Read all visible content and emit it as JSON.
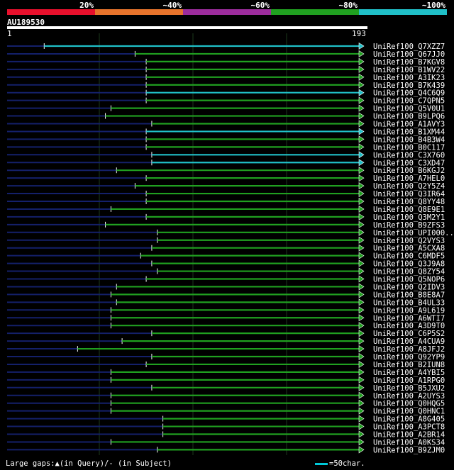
{
  "header": {
    "query_id": "AU189530",
    "ruler_start": "1",
    "ruler_end": "193"
  },
  "color_legend": [
    {
      "label": "20%",
      "color": "#e8102c"
    },
    {
      "label": "~40%",
      "color": "#e8742c"
    },
    {
      "label": "~60%",
      "color": "#9c2c9c"
    },
    {
      "label": "~80%",
      "color": "#20a020"
    },
    {
      "label": "~100%",
      "color": "#20c0c8"
    }
  ],
  "footer": {
    "gaps_text": "Large gaps:▲(in Query)/- (in Subject)",
    "scale_text": "=50char."
  },
  "chart_data": {
    "type": "alignment",
    "query_length": 193,
    "hits": [
      {
        "name": "UniRef100_Q7XZZ7",
        "start": 21,
        "end": 193,
        "identity": "~100%"
      },
      {
        "name": "UniRef100_Q67JJ0",
        "start": 70,
        "end": 193,
        "identity": "~80%"
      },
      {
        "name": "UniRef100_B7KGV8",
        "start": 76,
        "end": 193,
        "identity": "~80%"
      },
      {
        "name": "UniRef100_B1WV22",
        "start": 76,
        "end": 193,
        "identity": "~80%"
      },
      {
        "name": "UniRef100_A3IK23",
        "start": 76,
        "end": 193,
        "identity": "~80%"
      },
      {
        "name": "UniRef100_B7K439",
        "start": 76,
        "end": 193,
        "identity": "~80%"
      },
      {
        "name": "UniRef100_Q4C6Q9",
        "start": 76,
        "end": 193,
        "identity": "~100%"
      },
      {
        "name": "UniRef100_C7QPN5",
        "start": 76,
        "end": 193,
        "identity": "~80%"
      },
      {
        "name": "UniRef100_Q5V0U1",
        "start": 57,
        "end": 193,
        "identity": "~80%"
      },
      {
        "name": "UniRef100_B9LPQ6",
        "start": 54,
        "end": 193,
        "identity": "~80%"
      },
      {
        "name": "UniRef100_A1AVY3",
        "start": 79,
        "end": 193,
        "identity": "~80%"
      },
      {
        "name": "UniRef100_B1XM44",
        "start": 76,
        "end": 193,
        "identity": "~100%"
      },
      {
        "name": "UniRef100_B4B3W4",
        "start": 76,
        "end": 193,
        "identity": "~80%"
      },
      {
        "name": "UniRef100_B0C117",
        "start": 76,
        "end": 193,
        "identity": "~80%"
      },
      {
        "name": "UniRef100_C3X760",
        "start": 79,
        "end": 193,
        "identity": "~100%"
      },
      {
        "name": "UniRef100_C3XD47",
        "start": 79,
        "end": 193,
        "identity": "~100%"
      },
      {
        "name": "UniRef100_B6KGJ2",
        "start": 60,
        "end": 193,
        "identity": "~80%"
      },
      {
        "name": "UniRef100_A7HEL0",
        "start": 76,
        "end": 193,
        "identity": "~80%"
      },
      {
        "name": "UniRef100_Q2Y5Z4",
        "start": 70,
        "end": 193,
        "identity": "~80%"
      },
      {
        "name": "UniRef100_Q3IR64",
        "start": 76,
        "end": 193,
        "identity": "~80%"
      },
      {
        "name": "UniRef100_Q8YY48",
        "start": 76,
        "end": 193,
        "identity": "~80%"
      },
      {
        "name": "UniRef100_Q8E9E1",
        "start": 57,
        "end": 193,
        "identity": "~80%"
      },
      {
        "name": "UniRef100_Q3M2Y1",
        "start": 76,
        "end": 193,
        "identity": "~80%"
      },
      {
        "name": "UniRef100_B9ZFS3",
        "start": 54,
        "end": 193,
        "identity": "~80%"
      },
      {
        "name": "UniRef100_UPI000..",
        "start": 82,
        "end": 193,
        "identity": "~80%"
      },
      {
        "name": "UniRef100_Q2VYS3",
        "start": 82,
        "end": 193,
        "identity": "~80%"
      },
      {
        "name": "UniRef100_A5CXA8",
        "start": 79,
        "end": 193,
        "identity": "~80%"
      },
      {
        "name": "UniRef100_C6MDF5",
        "start": 73,
        "end": 193,
        "identity": "~80%"
      },
      {
        "name": "UniRef100_Q3J9A8",
        "start": 79,
        "end": 193,
        "identity": "~80%"
      },
      {
        "name": "UniRef100_Q8ZY54",
        "start": 82,
        "end": 193,
        "identity": "~80%"
      },
      {
        "name": "UniRef100_Q5NOP6",
        "start": 76,
        "end": 193,
        "identity": "~80%"
      },
      {
        "name": "UniRef100_Q2IDV3",
        "start": 60,
        "end": 193,
        "identity": "~80%"
      },
      {
        "name": "UniRef100_B8E8A7",
        "start": 57,
        "end": 193,
        "identity": "~80%"
      },
      {
        "name": "UniRef100_B4UL33",
        "start": 60,
        "end": 193,
        "identity": "~80%"
      },
      {
        "name": "UniRef100_A9L619",
        "start": 57,
        "end": 193,
        "identity": "~80%"
      },
      {
        "name": "UniRef100_A6WTI7",
        "start": 57,
        "end": 193,
        "identity": "~80%"
      },
      {
        "name": "UniRef100_A3D9T0",
        "start": 57,
        "end": 193,
        "identity": "~80%"
      },
      {
        "name": "UniRef100_C6P5S2",
        "start": 79,
        "end": 193,
        "identity": "~80%"
      },
      {
        "name": "UniRef100_A4CUA9",
        "start": 63,
        "end": 193,
        "identity": "~80%"
      },
      {
        "name": "UniRef100_A8JFJ2",
        "start": 39,
        "end": 193,
        "identity": "~80%"
      },
      {
        "name": "UniRef100_Q92YP9",
        "start": 79,
        "end": 193,
        "identity": "~80%"
      },
      {
        "name": "UniRef100_B2IUN8",
        "start": 76,
        "end": 193,
        "identity": "~80%"
      },
      {
        "name": "UniRef100_A4YBI5",
        "start": 57,
        "end": 193,
        "identity": "~80%"
      },
      {
        "name": "UniRef100_A1RPG0",
        "start": 57,
        "end": 193,
        "identity": "~80%"
      },
      {
        "name": "UniRef100_B5JXU2",
        "start": 79,
        "end": 193,
        "identity": "~80%"
      },
      {
        "name": "UniRef100_A2UYS3",
        "start": 57,
        "end": 193,
        "identity": "~80%"
      },
      {
        "name": "UniRef100_Q0HQG5",
        "start": 57,
        "end": 193,
        "identity": "~80%"
      },
      {
        "name": "UniRef100_Q0HNC1",
        "start": 57,
        "end": 193,
        "identity": "~80%"
      },
      {
        "name": "UniRef100_A8G405",
        "start": 85,
        "end": 193,
        "identity": "~80%"
      },
      {
        "name": "UniRef100_A3PCT8",
        "start": 85,
        "end": 193,
        "identity": "~80%"
      },
      {
        "name": "UniRef100_A2BR14",
        "start": 85,
        "end": 193,
        "identity": "~80%"
      },
      {
        "name": "UniRef100_A0KS34",
        "start": 57,
        "end": 193,
        "identity": "~80%"
      },
      {
        "name": "UniRef100_B9ZJM0",
        "start": 82,
        "end": 193,
        "identity": "~80%"
      }
    ]
  }
}
